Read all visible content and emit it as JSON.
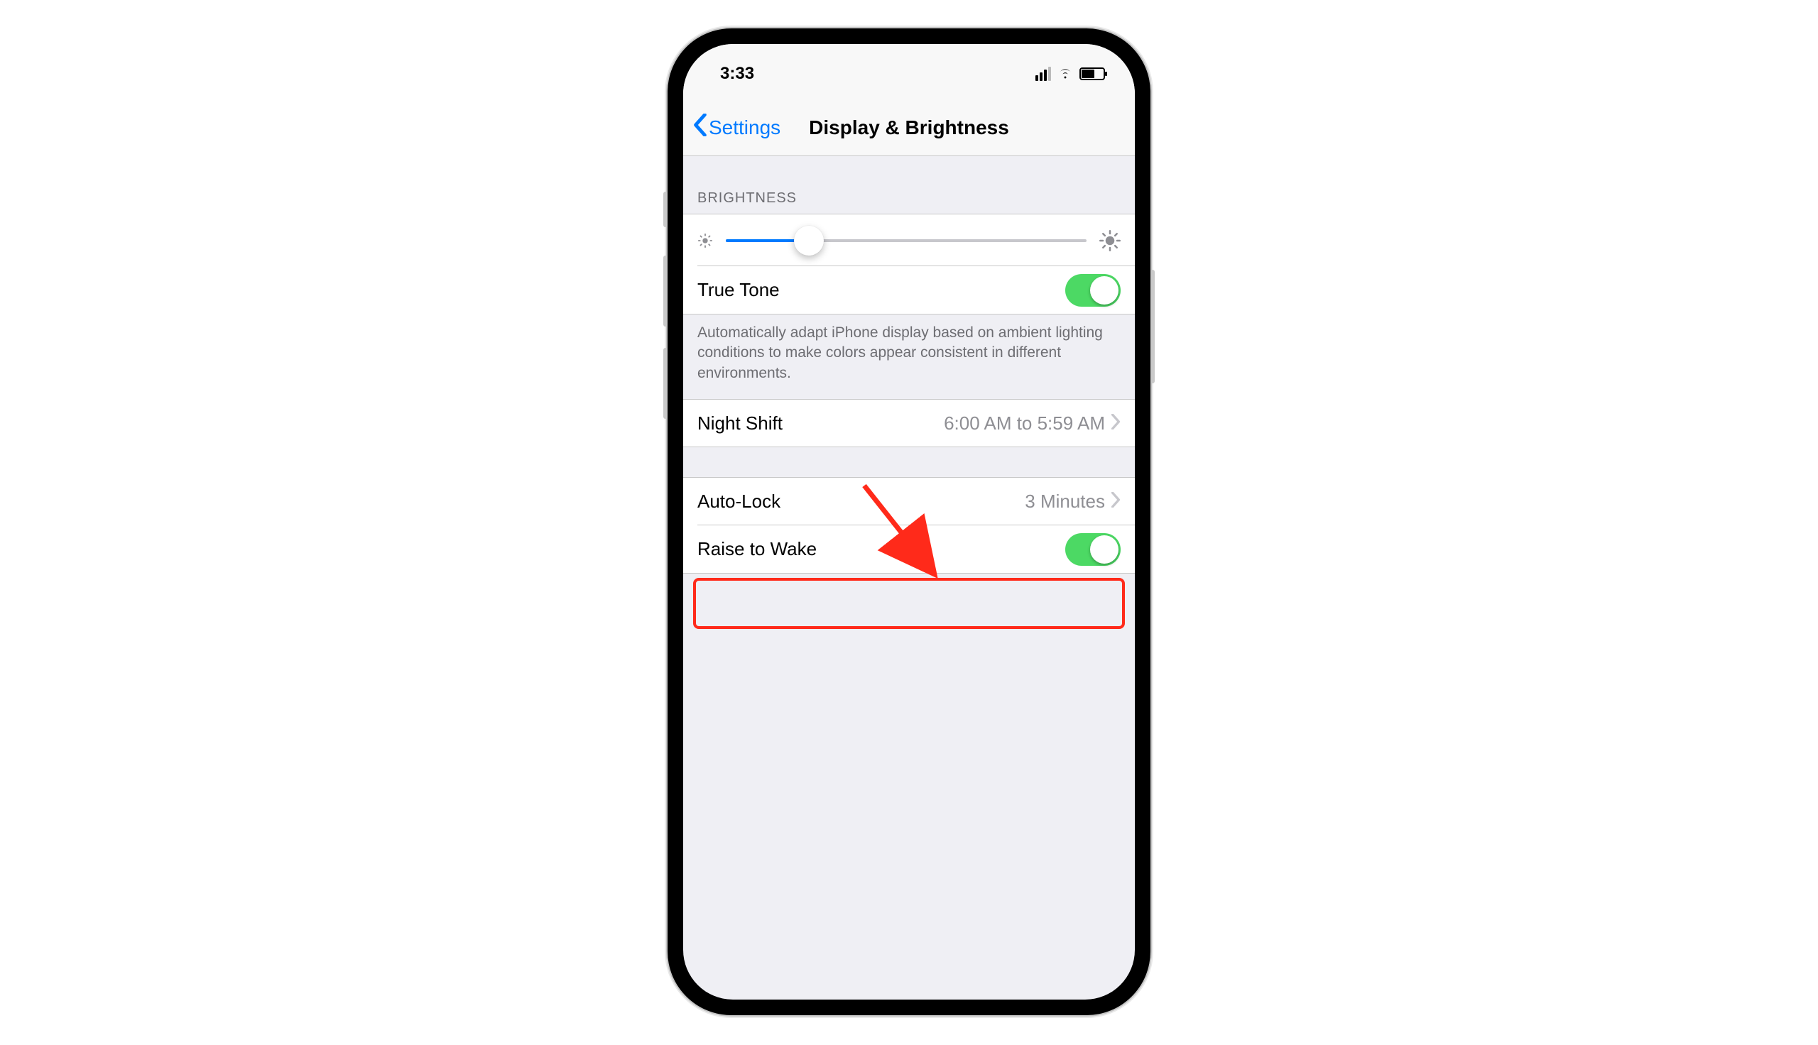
{
  "status": {
    "time": "3:33"
  },
  "nav": {
    "back_label": "Settings",
    "title": "Display & Brightness"
  },
  "sections": {
    "brightness_header": "BRIGHTNESS",
    "brightness_value_pct": 23,
    "true_tone": {
      "label": "True Tone",
      "on": true
    },
    "true_tone_footer": "Automatically adapt iPhone display based on ambient lighting conditions to make colors appear consistent in different environments.",
    "night_shift": {
      "label": "Night Shift",
      "value": "6:00 AM to 5:59 AM"
    },
    "auto_lock": {
      "label": "Auto-Lock",
      "value": "3 Minutes"
    },
    "raise_to_wake": {
      "label": "Raise to Wake",
      "on": true
    }
  },
  "colors": {
    "link": "#007aff",
    "switch_on": "#4cd964",
    "highlight": "#ff2a1a"
  }
}
